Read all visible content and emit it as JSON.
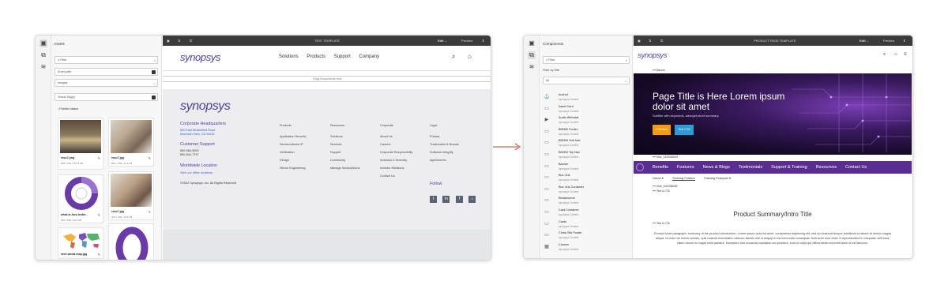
{
  "left_window": {
    "rail_icons": [
      "assets-icon",
      "content-tree-icon",
      "layers-icon"
    ],
    "panel_title": "Assets",
    "filter_placeholder": "Filter",
    "path_placeholder": "Enter path",
    "type_select": "Images",
    "tags_placeholder": "Select Tag(s)",
    "publish_status": "Publish status",
    "assets": [
      {
        "name": "rxsu7.png",
        "meta": "908 x 630 | 702.3 KB"
      },
      {
        "name": "rxsu7.jpg",
        "meta": "300 x 320 | 14.6 KB"
      },
      {
        "name": "what-is-fuzz-testin...",
        "meta": "640 x 960 | 29.6 KB"
      },
      {
        "name": "rxsu7.jpg",
        "meta": "300 x 320 | 14.6 KB"
      },
      {
        "name": "sere-world-map.jpg",
        "meta": ""
      }
    ],
    "toolbar": {
      "title": "TEST TEMPLATE",
      "mode": "Edit",
      "preview": "Preview"
    },
    "header": {
      "logo": "synopsys",
      "nav": [
        "Solutions",
        "Products",
        "Support",
        "Company"
      ]
    },
    "drop_zone": "Drag components here",
    "footer": {
      "logo": "synopsys",
      "hq_title": "Corporate Headquarters",
      "hq_address": [
        "690 East Middlefield Road",
        "Mountain View, CA 94043"
      ],
      "support_title": "Customer Support",
      "support_phones": [
        "650-584-5000",
        "800-541-7737"
      ],
      "worldwide_title": "Worldwide Location",
      "worldwide_link": "View our office locations",
      "copyright": "©2022 Synopsys, Inc. All Rights Reserved",
      "columns": [
        {
          "title": "Products",
          "items": [
            "Application Security",
            "Semiconductor IP",
            "Verification",
            "Design",
            "Silicon Engineering"
          ]
        },
        {
          "title": "Resources",
          "items": [
            "Solutions",
            "Services",
            "Support",
            "Community",
            "Manage Subscriptions"
          ]
        },
        {
          "title": "Corporate",
          "items": [
            "About Us",
            "Careers",
            "Corporate Responsibility",
            "Inclusion & Diversity",
            "Investor Relations",
            "Contact Us"
          ]
        },
        {
          "title": "Legal",
          "items": [
            "Privacy",
            "Trademarks & Brands",
            "Software Integrity",
            "Agreements"
          ]
        }
      ],
      "follow": "Follow"
    }
  },
  "right_window": {
    "panel_title": "Components",
    "filter_placeholder": "Filter",
    "filter_by_site": "Filter by Site",
    "site_select": "All",
    "components": [
      {
        "name": "Anchor",
        "site": "synopsys Content",
        "icon": "⚓"
      },
      {
        "name": "Asset Card",
        "site": "synopsys Content",
        "icon": "▭"
      },
      {
        "name": "Audio Webcast",
        "site": "synopsys Content",
        "icon": "▶"
      },
      {
        "name": "BDMW Footer",
        "site": "synopsys Content",
        "icon": "▭"
      },
      {
        "name": "BDMW Sub Nav",
        "site": "synopsys Content",
        "icon": "▭"
      },
      {
        "name": "BDMW Top Nav",
        "site": "synopsys Content",
        "icon": "▭"
      },
      {
        "name": "Banner",
        "site": "synopsys Content",
        "icon": "▭"
      },
      {
        "name": "Box Link",
        "site": "synopsys Content",
        "icon": "▭"
      },
      {
        "name": "Box Link Container",
        "site": "synopsys Content",
        "icon": "▭"
      },
      {
        "name": "Breadcrumb",
        "site": "synopsys Content",
        "icon": "▭"
      },
      {
        "name": "Card Container",
        "site": "synopsys Content",
        "icon": "▭"
      },
      {
        "name": "Cards",
        "site": "synopsys Content",
        "icon": "▭"
      },
      {
        "name": "China Site Footer",
        "site": "synopsys Content",
        "icon": "▭"
      },
      {
        "name": "Column",
        "site": "synopsys Content",
        "icon": "▦"
      }
    ],
    "toolbar": {
      "title": "PRODUCT PAGE TEMPLATE",
      "mode": "Edit",
      "preview": "Preview"
    },
    "logo": "synopsys",
    "banner_tag": "Banner",
    "hero_title": "Page Title is Here Lorem ipsum dolor sit amet",
    "hero_subtitle": "Subtitle with keywords, adsoget,short summary.",
    "cta_primary": "CTA text",
    "cta_secondary": "Text CTA",
    "html_tag_1": "html_1425405209",
    "nav": [
      "Benefits",
      "Features",
      "News & Blogs",
      "Testimonials",
      "Support & Training",
      "Resources",
      "Contact Us"
    ],
    "breadcrumbs": [
      "Home",
      "Training Folders",
      "Training Example"
    ],
    "html_tag_2": "html_1116788282",
    "text_cta_tag_1": "Text & CTA",
    "summary_title": "Product Summary/Intro Title",
    "text_cta_tag_2": "Text & CTA",
    "summary_body": "Product short paragraph, summary of the product introduction. Lorem ipsum dolor sit amet, consectetur adipiscing elit, sed do eiusmod tempor incididunt ut labore et dolore magna aliqua. Ut enim ad minim veniam, quis nostrud exercitation ullamco laboris nisi ut aliquip ex ea commodo consequat. Duis aute irure dolor in reprehenderit in voluptate velit esse cillum dolore eu fugiat nulla pariatur. Excepteur sint occaecat cupidatat non proident, sunt in culpa qui officia deserunt mollit anim id est laborum."
  },
  "colors": {
    "brand_purple": "#5a2d91",
    "cta_orange": "#f39c12",
    "cta_blue": "#2d9bd6",
    "arrow_red": "#d9342b",
    "toolbar": "#3b3b3b"
  }
}
